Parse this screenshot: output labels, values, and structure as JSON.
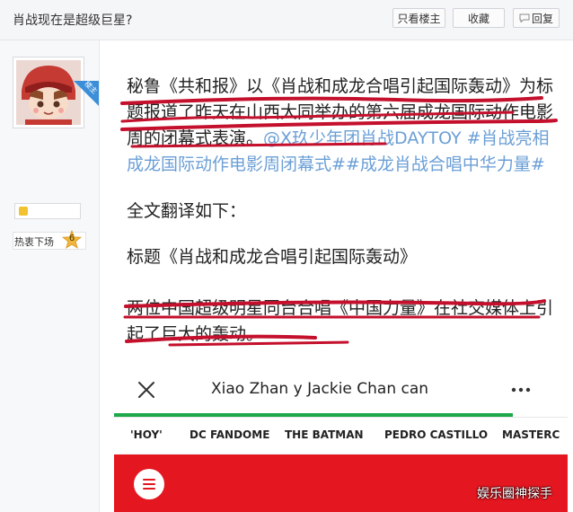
{
  "page": {
    "title": "肖战现在是超级巨星?"
  },
  "toolbar": {
    "only_op": "只看楼主",
    "favorite": "收藏",
    "reply": "回复"
  },
  "author": {
    "corner_label": "楼主",
    "level_name": "热衷下场",
    "level_num": "6"
  },
  "post": {
    "para1_main": "秘鲁《共和报》以《肖战和成龙合唱引起国际轰动》为标题报道了昨天在山西大同举办的第六届成龙国际动作电影周的闭幕式表演。",
    "para1_tags": "@X玖少年团肖战DAYTOY #肖战亮相成龙国际动作电影周闭幕式##成龙肖战合唱中华力量#",
    "para2": "全文翻译如下：",
    "para3": "标题《肖战和成龙合唱引起国际轰动》",
    "para4": "两位中国超级明星同台合唱《中国力量》在社交媒体上引起了巨大的轰动。"
  },
  "embed": {
    "title": "Xiao Zhan y Jackie Chan can",
    "progress": 0.88,
    "nav": [
      "'HOY'",
      "DC FANDOME",
      "THE BATMAN",
      "PEDRO CASTILLO",
      "MASTERC"
    ]
  },
  "watermark": "娱乐圈神探手",
  "colors": {
    "accent_blue": "#3b8ed8",
    "underline_red": "#c4102c",
    "hashtag_blue": "#6b9fd6",
    "progress_green": "#1ea84a",
    "band_red": "#e4161f"
  },
  "icons": [
    "reply-icon",
    "close-icon",
    "more-icon",
    "menu-icon",
    "badge-icon",
    "level-star-icon"
  ]
}
